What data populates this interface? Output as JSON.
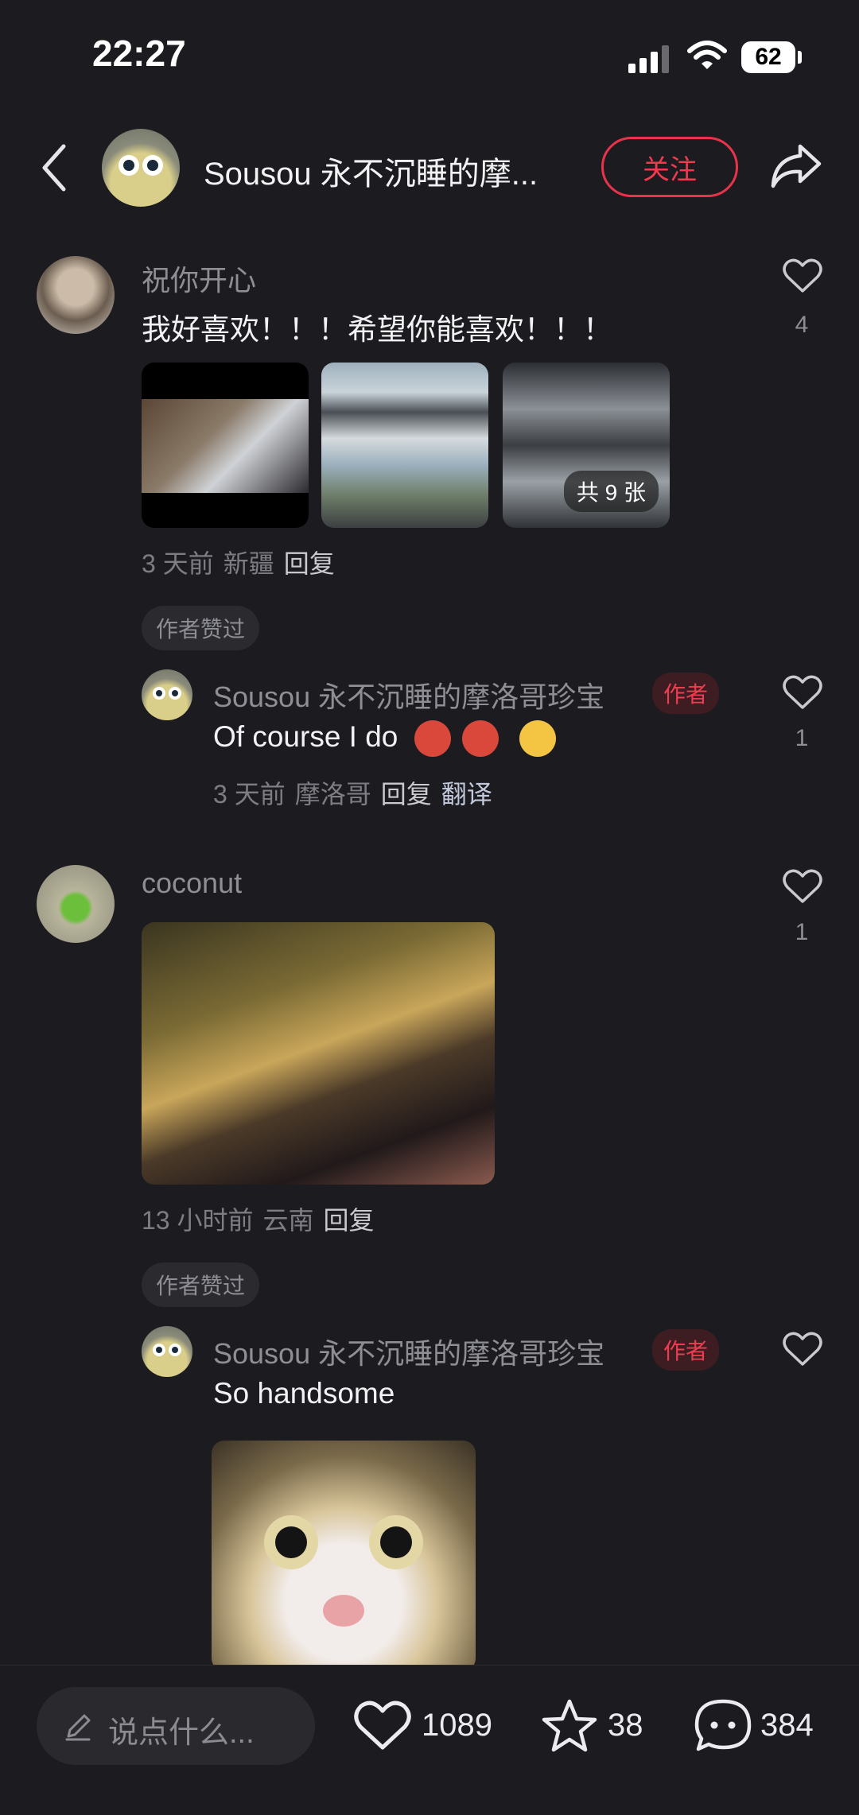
{
  "status_bar": {
    "time": "22:27",
    "battery": "62"
  },
  "header": {
    "title": "Sousou 永不沉睡的摩...",
    "follow_label": "关注"
  },
  "comments": [
    {
      "user": "祝你开心",
      "text": "我好喜欢！！！希望你能喜欢！！！",
      "likes": "4",
      "image_count_label": "共 9 张",
      "time": "3 天前",
      "location": "新疆",
      "reply_label": "回复",
      "badge": "作者赞过",
      "reply": {
        "user": "Sousou 永不沉睡的摩洛哥珍宝",
        "author_tag": "作者",
        "text": "Of course I do",
        "likes": "1",
        "time": "3 天前",
        "location": "摩洛哥",
        "reply_label": "回复",
        "translate_label": "翻译"
      }
    },
    {
      "user": "coconut",
      "likes": "1",
      "time": "13 小时前",
      "location": "云南",
      "reply_label": "回复",
      "badge": "作者赞过",
      "reply": {
        "user": "Sousou 永不沉睡的摩洛哥珍宝",
        "author_tag": "作者",
        "text": "So handsome"
      }
    }
  ],
  "bottom_bar": {
    "input_placeholder": "说点什么...",
    "likes": "1089",
    "favorites": "38",
    "comments": "384"
  },
  "colors": {
    "accent": "#f03a50",
    "background": "#1c1c20"
  }
}
